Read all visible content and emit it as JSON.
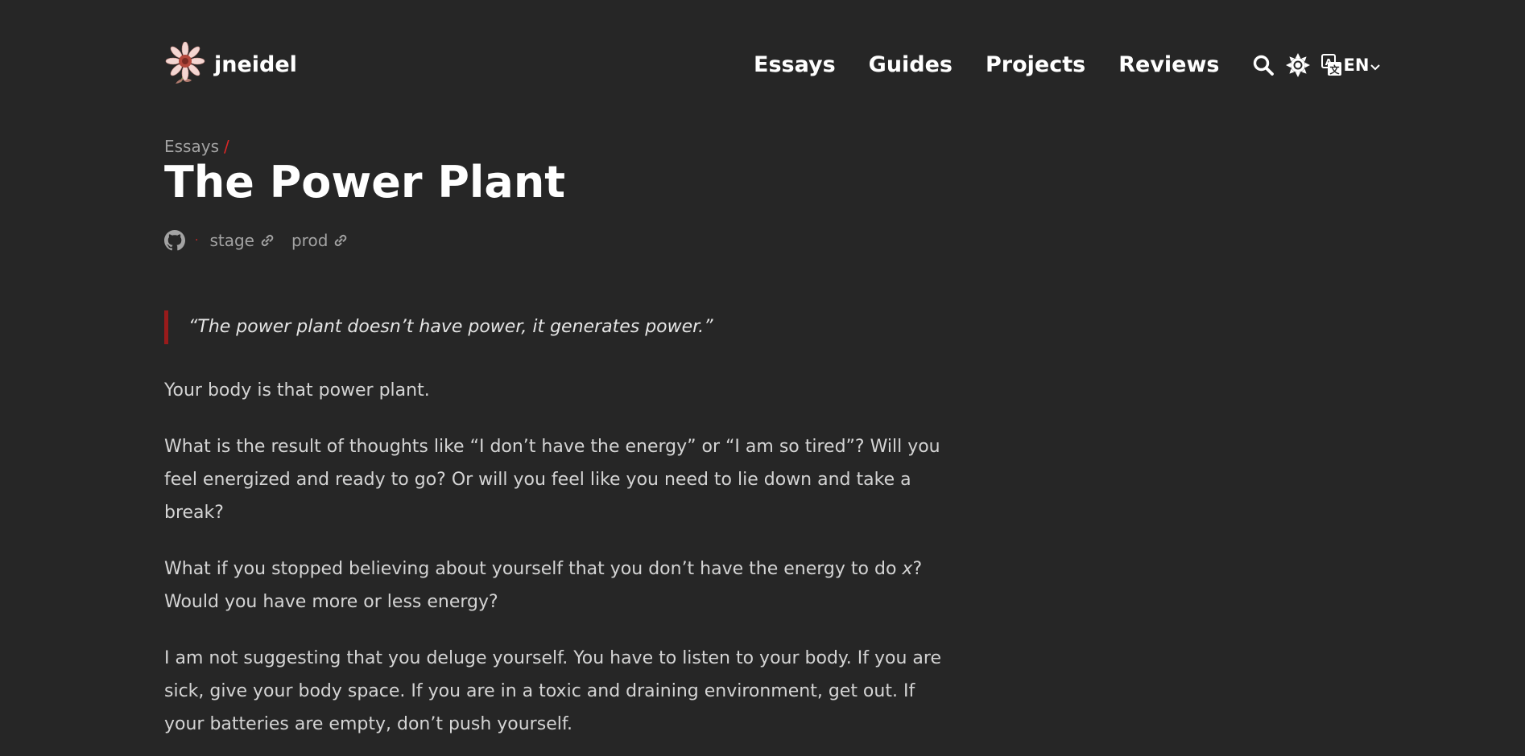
{
  "header": {
    "site_name": "jneidel",
    "nav": [
      "Essays",
      "Guides",
      "Projects",
      "Reviews"
    ],
    "language": "EN"
  },
  "breadcrumb": {
    "section": "Essays",
    "separator": "/"
  },
  "article": {
    "title": "The Power Plant",
    "meta": {
      "separator": "·",
      "links": [
        "stage",
        "prod"
      ]
    },
    "quote": "“The power plant doesn’t have power, it generates power.”",
    "paragraphs": {
      "p1": "Your body is that power plant.",
      "p2": "What is the result of thoughts like “I don’t have the energy” or “I am so tired”? Will you feel energized and ready to go? Or will you feel like you need to lie down and take a break?",
      "p3_before": "What if you stopped believing about yourself that you don’t have the energy to do ",
      "p3_italic": "x",
      "p3_after": "? Would you have more or less energy?",
      "p4": "I am not suggesting that you deluge yourself. You have to listen to your body. If you are sick, give your body space. If you are in a toxic and draining environment, get out. If your batteries are empty, don’t push yourself."
    }
  },
  "colors": {
    "background": "#262626",
    "accent": "#dc2626",
    "quote_border": "#991b1b"
  },
  "icons": [
    "flower-logo-icon",
    "search-icon",
    "theme-toggle-icon",
    "translate-icon",
    "chevron-down-icon",
    "github-icon",
    "link-icon"
  ]
}
